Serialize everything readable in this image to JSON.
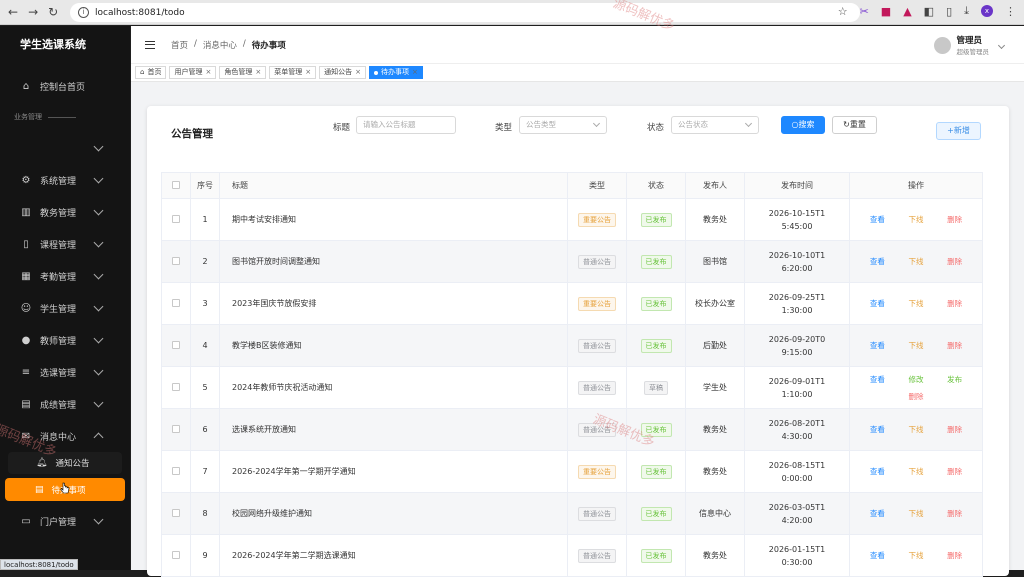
{
  "browser": {
    "url": "localhost:8081/todo",
    "status_url": "localhost:8081/todo",
    "profile_initial": "x"
  },
  "sidebar": {
    "brand": "学生选课系统",
    "home": "控制台首页",
    "group_label": "业务管理",
    "items": [
      {
        "label": "系统管理",
        "icon": "gear-icon"
      },
      {
        "label": "教务管理",
        "icon": "building-icon"
      },
      {
        "label": "课程管理",
        "icon": "book-icon"
      },
      {
        "label": "考勤管理",
        "icon": "calendar-icon"
      },
      {
        "label": "学生管理",
        "icon": "user-icon"
      },
      {
        "label": "教师管理",
        "icon": "teacher-icon"
      },
      {
        "label": "选课管理",
        "icon": "list-icon"
      },
      {
        "label": "成绩管理",
        "icon": "document-icon"
      },
      {
        "label": "消息中心",
        "icon": "mail-icon"
      }
    ],
    "sub_items": [
      {
        "label": "通知公告",
        "icon": "bell-icon"
      },
      {
        "label": "待办事项",
        "icon": "todo-icon"
      }
    ],
    "last_item": {
      "label": "门户管理",
      "icon": "monitor-icon"
    }
  },
  "topbar": {
    "breadcrumb": [
      "首页",
      "消息中心",
      "待办事项"
    ],
    "user_name": "管理员",
    "user_role": "超级管理员"
  },
  "tabs": [
    {
      "label": "首页",
      "closable": false,
      "active": false
    },
    {
      "label": "用户管理",
      "closable": true,
      "active": false
    },
    {
      "label": "角色管理",
      "closable": true,
      "active": false
    },
    {
      "label": "菜单管理",
      "closable": true,
      "active": false
    },
    {
      "label": "通知公告",
      "closable": true,
      "active": false
    },
    {
      "label": "待办事项",
      "closable": true,
      "active": true
    }
  ],
  "panel": {
    "title": "公告管理",
    "filters": {
      "title_label": "标题",
      "title_placeholder": "请输入公告标题",
      "type_label": "类型",
      "type_placeholder": "公告类型",
      "status_label": "状态",
      "status_placeholder": "公告状态"
    },
    "search_label": "搜索",
    "reset_label": "重置",
    "add_label": "新增"
  },
  "table": {
    "columns": [
      "序号",
      "标题",
      "类型",
      "状态",
      "发布人",
      "发布时间",
      "操作"
    ],
    "rows": [
      {
        "no": "1",
        "title": "期中考试安排通知",
        "type": "重要公告",
        "type_style": "warn",
        "status": "已发布",
        "status_style": "succ",
        "publisher": "教务处",
        "time": "2026-10-15T15:45:00",
        "ops": [
          [
            "查看",
            "blue"
          ],
          [
            "下线",
            "orange"
          ],
          [
            "删除",
            "red"
          ]
        ]
      },
      {
        "no": "2",
        "title": "图书馆开放时间调整通知",
        "type": "普通公告",
        "type_style": "info",
        "status": "已发布",
        "status_style": "succ",
        "publisher": "图书馆",
        "time": "2026-10-10T16:20:00",
        "ops": [
          [
            "查看",
            "blue"
          ],
          [
            "下线",
            "orange"
          ],
          [
            "删除",
            "red"
          ]
        ]
      },
      {
        "no": "3",
        "title": "2023年国庆节放假安排",
        "type": "重要公告",
        "type_style": "warn",
        "status": "已发布",
        "status_style": "succ",
        "publisher": "校长办公室",
        "time": "2026-09-25T11:30:00",
        "ops": [
          [
            "查看",
            "blue"
          ],
          [
            "下线",
            "orange"
          ],
          [
            "删除",
            "red"
          ]
        ]
      },
      {
        "no": "4",
        "title": "教学楼B区装修通知",
        "type": "普通公告",
        "type_style": "info",
        "status": "已发布",
        "status_style": "succ",
        "publisher": "后勤处",
        "time": "2026-09-20T09:15:00",
        "ops": [
          [
            "查看",
            "blue"
          ],
          [
            "下线",
            "orange"
          ],
          [
            "删除",
            "red"
          ]
        ]
      },
      {
        "no": "5",
        "title": "2024年教师节庆祝活动通知",
        "type": "普通公告",
        "type_style": "info",
        "status": "草稿",
        "status_style": "info",
        "publisher": "学生处",
        "time": "2026-09-01T11:10:00",
        "ops": [
          [
            "查看",
            "blue"
          ],
          [
            "修改",
            "green"
          ],
          [
            "发布",
            "green"
          ],
          [
            "删除",
            "red"
          ]
        ]
      },
      {
        "no": "6",
        "title": "选课系统开放通知",
        "type": "普通公告",
        "type_style": "info",
        "status": "已发布",
        "status_style": "succ",
        "publisher": "教务处",
        "time": "2026-08-20T14:30:00",
        "ops": [
          [
            "查看",
            "blue"
          ],
          [
            "下线",
            "orange"
          ],
          [
            "删除",
            "red"
          ]
        ]
      },
      {
        "no": "7",
        "title": "2026-2024学年第一学期开学通知",
        "type": "重要公告",
        "type_style": "warn",
        "status": "已发布",
        "status_style": "succ",
        "publisher": "教务处",
        "time": "2026-08-15T10:00:00",
        "ops": [
          [
            "查看",
            "blue"
          ],
          [
            "下线",
            "orange"
          ],
          [
            "删除",
            "red"
          ]
        ]
      },
      {
        "no": "8",
        "title": "校园网络升级维护通知",
        "type": "普通公告",
        "type_style": "info",
        "status": "已发布",
        "status_style": "succ",
        "publisher": "信息中心",
        "time": "2026-03-05T14:20:00",
        "ops": [
          [
            "查看",
            "blue"
          ],
          [
            "下线",
            "orange"
          ],
          [
            "删除",
            "red"
          ]
        ]
      },
      {
        "no": "9",
        "title": "2026-2024学年第二学期选课通知",
        "type": "普通公告",
        "type_style": "info",
        "status": "已发布",
        "status_style": "succ",
        "publisher": "教务处",
        "time": "2026-01-15T10:30:00",
        "ops": [
          [
            "查看",
            "blue"
          ],
          [
            "下线",
            "orange"
          ],
          [
            "删除",
            "red"
          ]
        ]
      }
    ]
  },
  "watermarks": [
    "源码解优多",
    "源码解优多",
    "源码解优多"
  ],
  "colors": {
    "primary": "#1e88ff",
    "sidebar_active": "#ff8a00",
    "sidebar_bg": "#141414"
  }
}
